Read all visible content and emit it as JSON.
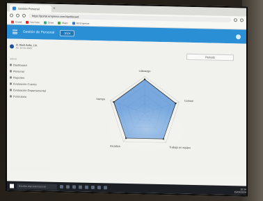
{
  "browser": {
    "tab_title": "Gestión Personal",
    "url": "https://portal.empresa.com/dashboard",
    "bookmarks": [
      "Gmail",
      "YouTube",
      "Drive",
      "Maps",
      "Mi Empresa"
    ]
  },
  "appbar": {
    "title": "Gestión de Personal",
    "period_button": "2024"
  },
  "user": {
    "name": "H. Bost Avila, Lin.",
    "id": "ID: 10-01-4482"
  },
  "sidebar": {
    "section": "MENÚ",
    "items": [
      "Dashboard",
      "Personal",
      "Reportes",
      "Evaluación Cuenta",
      "Evaluación Departamental",
      "Formulario"
    ]
  },
  "period_selector": {
    "label": "Periodo"
  },
  "chart_data": {
    "type": "radar",
    "axes": [
      "Liderazgo",
      "Comunicación",
      "Trabajo en equipo",
      "Iniciativa",
      "Gestión del tiempo"
    ],
    "max": 100,
    "series": [
      {
        "values": [
          92,
          90,
          88,
          88,
          90
        ],
        "color": "#4f8fd8"
      }
    ],
    "grid_levels": 4
  },
  "taskbar": {
    "search_placeholder": "Escribe aquí para buscar",
    "time": "10:24",
    "date": "15/03/2024"
  },
  "colors": {
    "accent": "#2b8fd6",
    "series": "#4f8fd8"
  }
}
